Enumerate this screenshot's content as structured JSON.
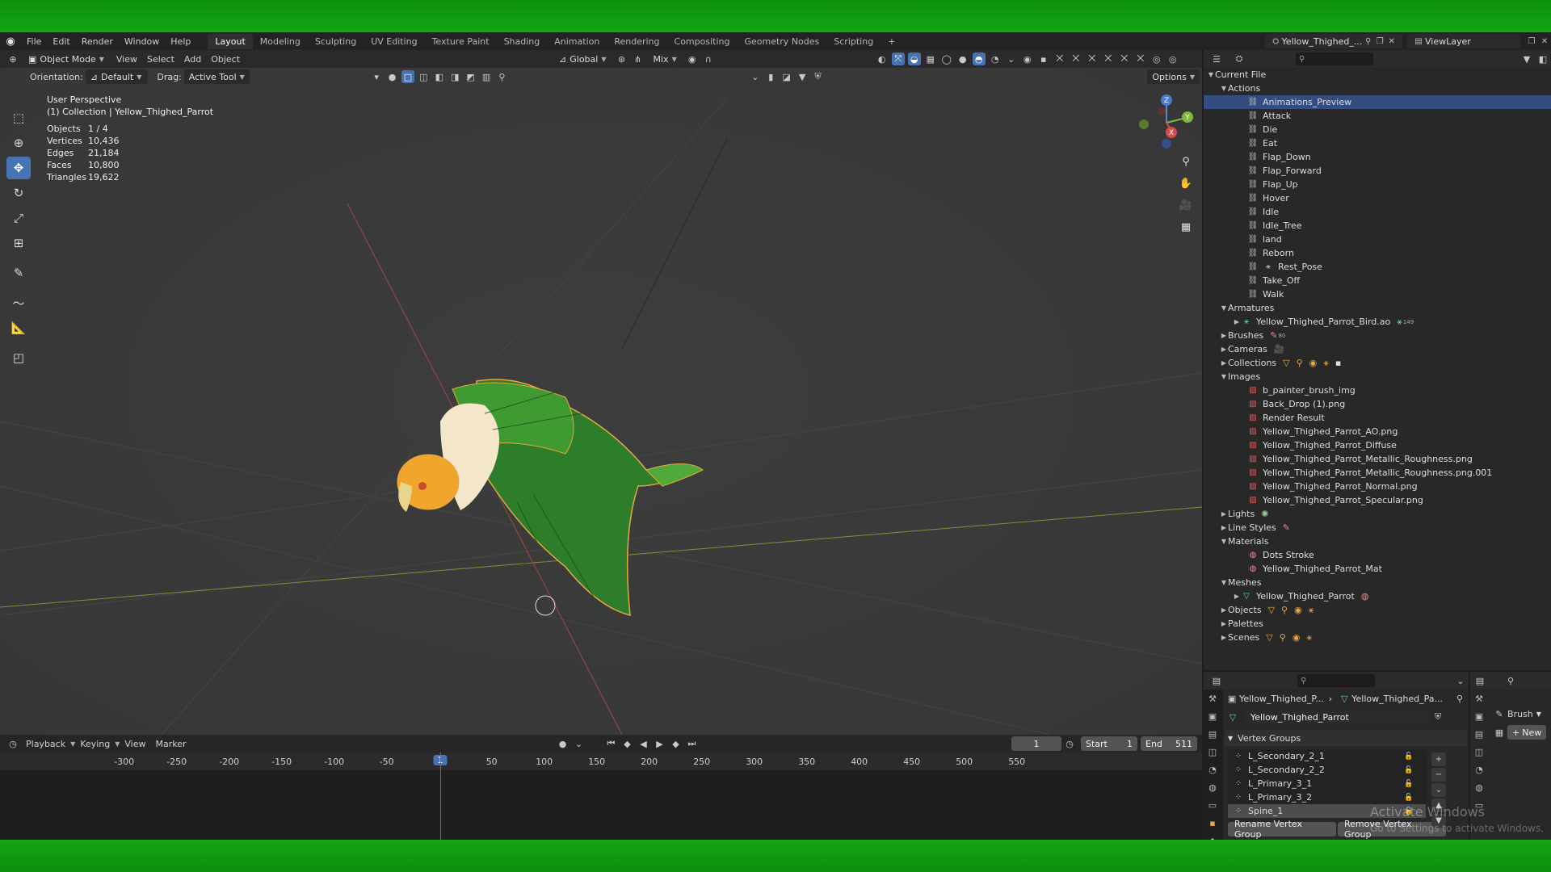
{
  "app": {
    "menus": [
      "File",
      "Edit",
      "Render",
      "Window",
      "Help"
    ],
    "workspaces": [
      "Layout",
      "Modeling",
      "Sculpting",
      "UV Editing",
      "Texture Paint",
      "Shading",
      "Animation",
      "Rendering",
      "Compositing",
      "Geometry Nodes",
      "Scripting"
    ],
    "active_workspace": "Layout",
    "add_workspace": "+",
    "scene_name": "Yellow_Thighed_...",
    "view_layer": "ViewLayer"
  },
  "viewport": {
    "mode": "Object Mode",
    "menus": [
      "View",
      "Select",
      "Add",
      "Object"
    ],
    "transform_orientation": "Global",
    "snap_mode": "Mix",
    "orientation_label": "Orientation:",
    "orientation_value": "Default",
    "drag_label": "Drag:",
    "drag_value": "Active Tool",
    "options_label": "Options",
    "perspective": "User Perspective",
    "collection_info": "(1) Collection | Yellow_Thighed_Parrot",
    "stats": [
      {
        "label": "Objects",
        "value": "1 / 4"
      },
      {
        "label": "Vertices",
        "value": "10,436"
      },
      {
        "label": "Edges",
        "value": "21,184"
      },
      {
        "label": "Faces",
        "value": "10,800"
      },
      {
        "label": "Triangles",
        "value": "19,622"
      }
    ],
    "gizmo_axes": {
      "x": "X",
      "y": "Y",
      "z": "Z"
    }
  },
  "timeline": {
    "menus": [
      "Playback",
      "Keying",
      "View",
      "Marker"
    ],
    "current_frame": "1",
    "start_label": "Start",
    "start_value": "1",
    "end_label": "End",
    "end_value": "511",
    "ticks": [
      "-300",
      "-250",
      "-200",
      "-150",
      "-100",
      "-50",
      "1",
      "50",
      "100",
      "150",
      "200",
      "250",
      "300",
      "350",
      "400",
      "450",
      "500",
      "550"
    ]
  },
  "outliner": {
    "root": "Current File",
    "actions_label": "Actions",
    "actions": [
      "Animations_Preview",
      "Attack",
      "Die",
      "Eat",
      "Flap_Down",
      "Flap_Forward",
      "Flap_Up",
      "Hover",
      "Idle",
      "Idle_Tree",
      "land",
      "Reborn",
      "Rest_Pose",
      "Take_Off",
      "Walk"
    ],
    "armatures_label": "Armatures",
    "armature_item": "Yellow_Thighed_Parrot_Bird.ao",
    "armature_count": "149",
    "brushes_label": "Brushes",
    "brushes_count": "80",
    "cameras_label": "Cameras",
    "collections_label": "Collections",
    "images_label": "Images",
    "images": [
      "b_painter_brush_img",
      "Back_Drop (1).png",
      "Render Result",
      "Yellow_Thighed_Parrot_AO.png",
      "Yellow_Thighed_Parrot_Diffuse",
      "Yellow_Thighed_Parrot_Metallic_Roughness.png",
      "Yellow_Thighed_Parrot_Metallic_Roughness.png.001",
      "Yellow_Thighed_Parrot_Normal.png",
      "Yellow_Thighed_Parrot_Specular.png"
    ],
    "lights_label": "Lights",
    "line_styles_label": "Line Styles",
    "materials_label": "Materials",
    "materials": [
      "Dots Stroke",
      "Yellow_Thighed_Parrot_Mat"
    ],
    "meshes_label": "Meshes",
    "mesh_item": "Yellow_Thighed_Parrot",
    "objects_label": "Objects",
    "palettes_label": "Palettes",
    "scenes_label": "Scenes"
  },
  "properties": {
    "breadcrumb_object": "Yellow_Thighed_P...",
    "breadcrumb_mesh": "Yellow_Thighed_Pa...",
    "mesh_name": "Yellow_Thighed_Parrot",
    "panel_title": "Vertex Groups",
    "vertex_groups": [
      "L_Secondary_2_1",
      "L_Secondary_2_2",
      "L_Primary_3_1",
      "L_Primary_3_2",
      "Spine_1"
    ],
    "rename_button": "Rename Vertex Group",
    "remove_button": "Remove Vertex Group"
  },
  "brush_panel": {
    "brush_label": "Brush",
    "new_label": "New"
  },
  "watermark": {
    "title": "Activate Windows",
    "subtitle": "Go to Settings to activate Windows."
  },
  "colors": {
    "accent": "#4772b3",
    "selection": "#334d80",
    "green_bg": "#14a614"
  }
}
